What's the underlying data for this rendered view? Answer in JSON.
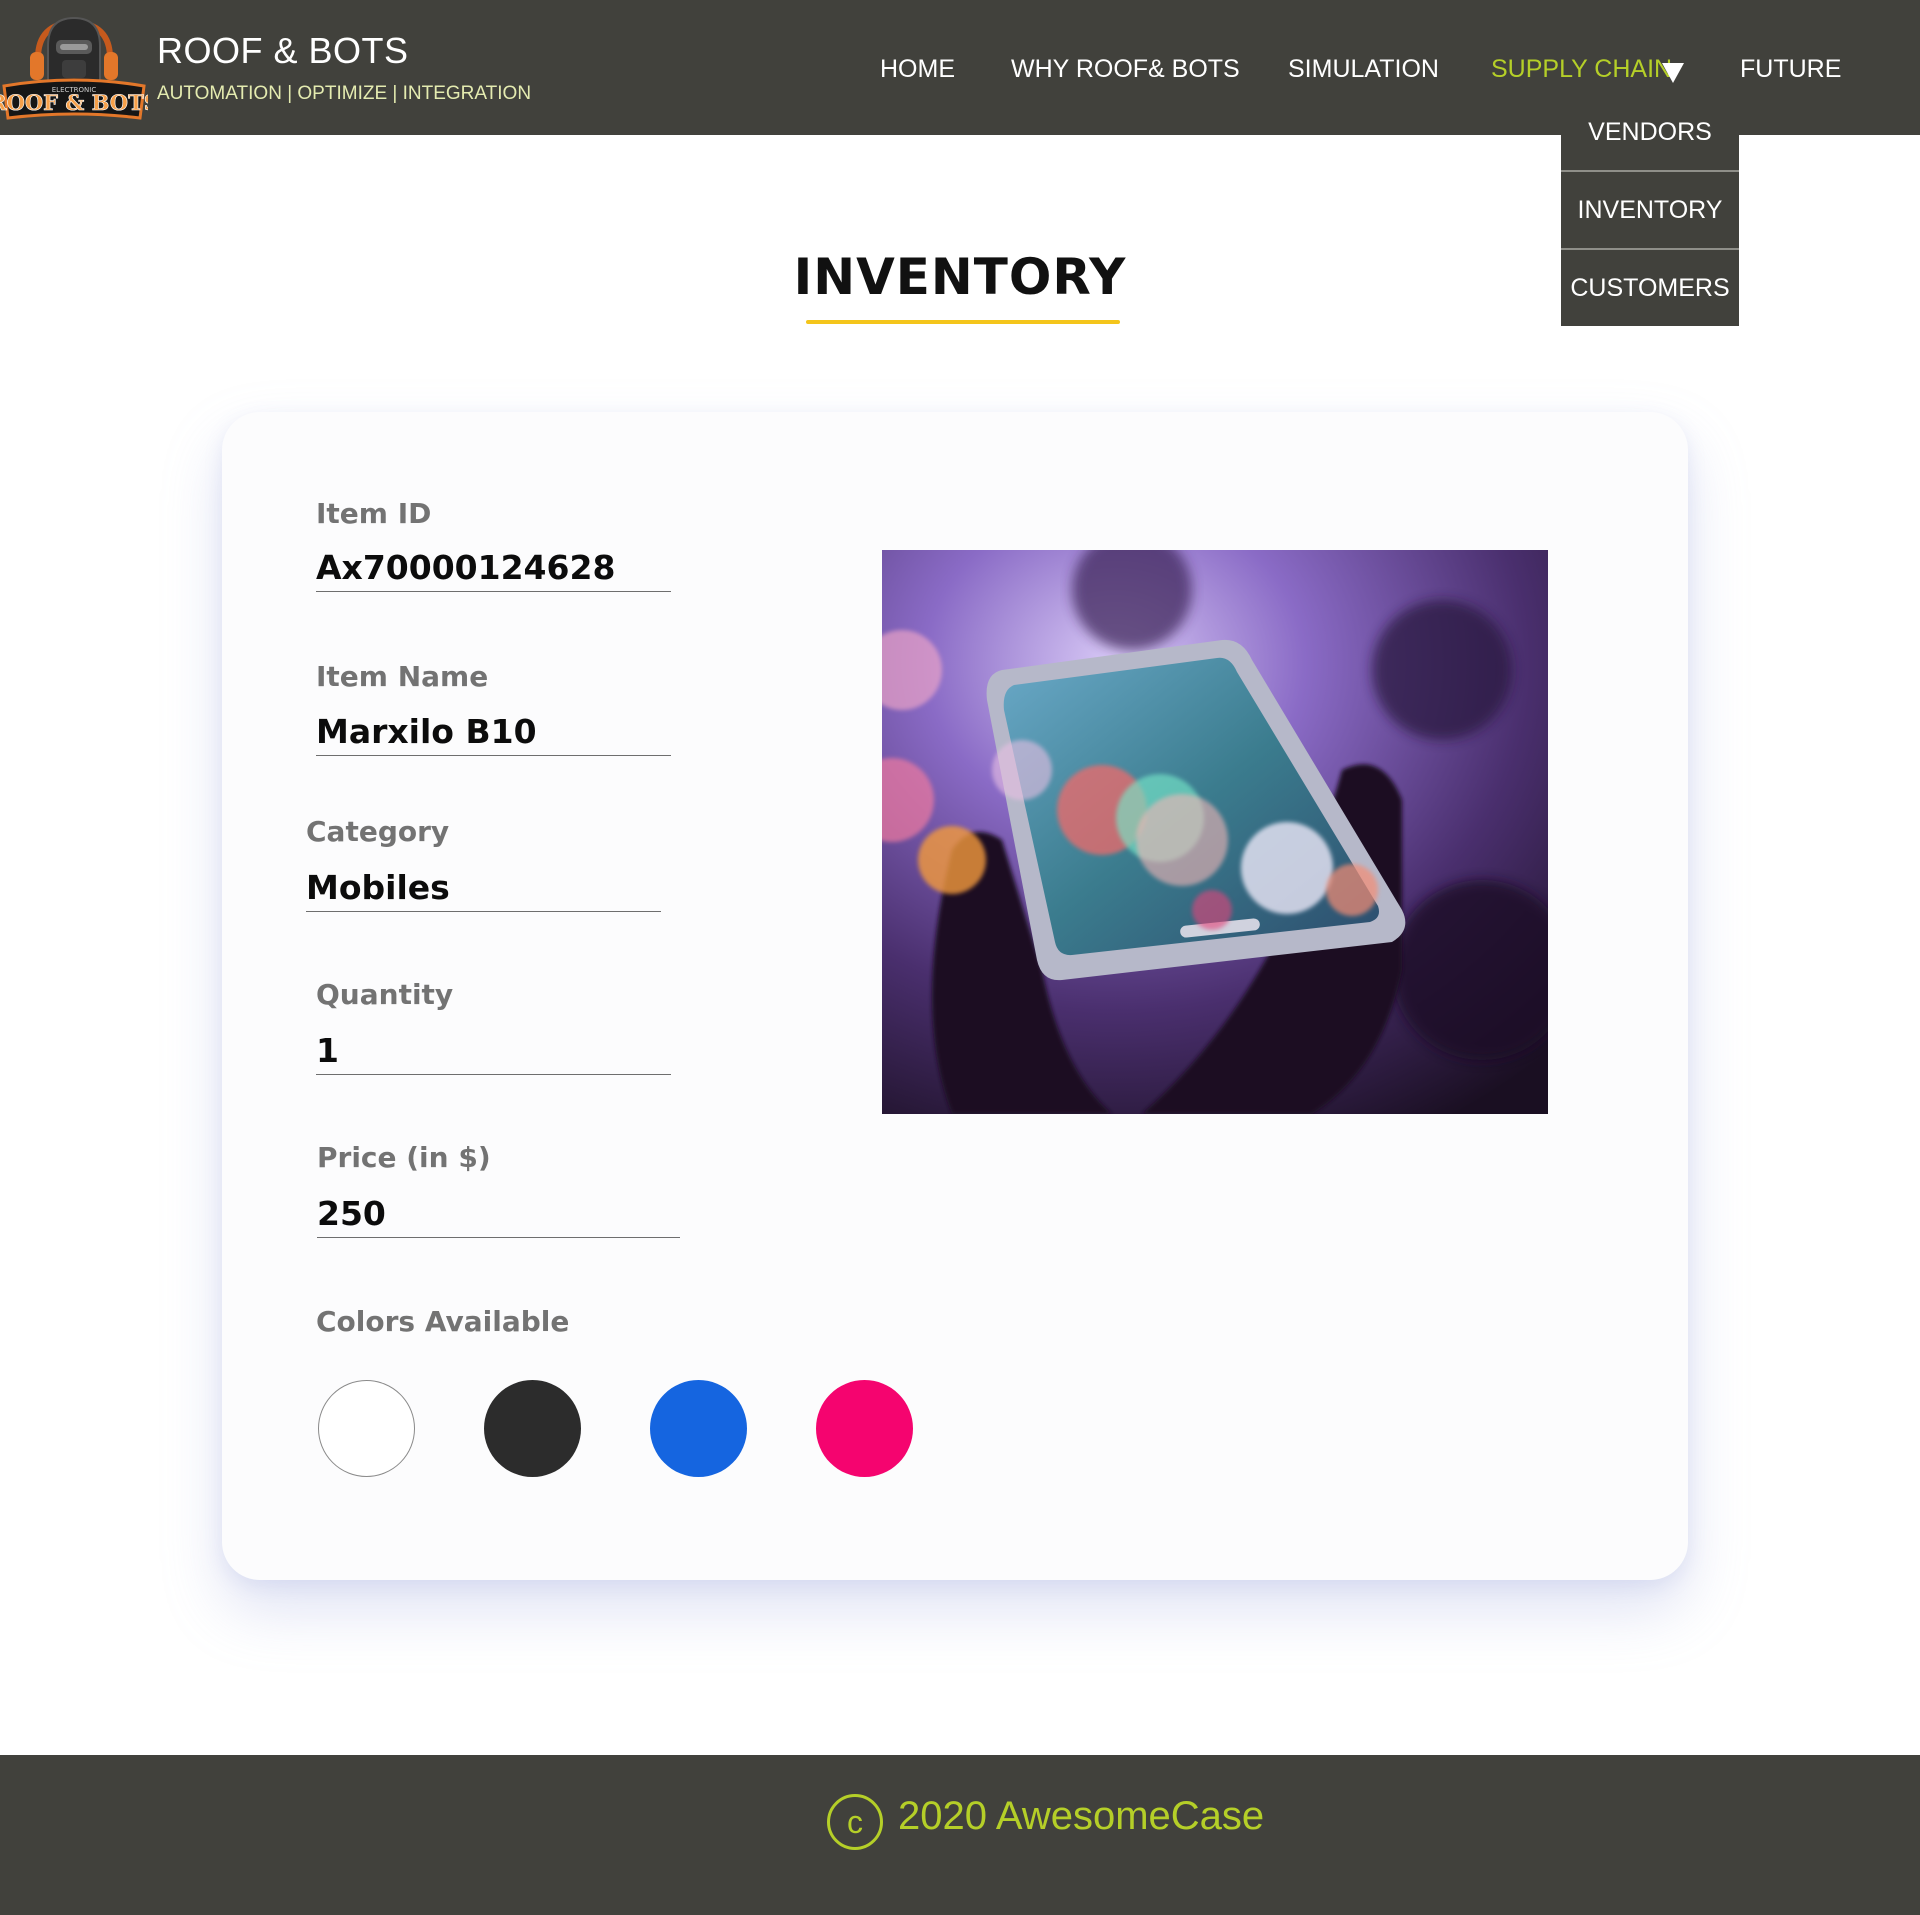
{
  "header": {
    "brand_title": "ROOF & BOTS",
    "brand_tagline": "AUTOMATION | OPTIMIZE | INTEGRATION",
    "logo_text_top": "ELECTRONIC",
    "logo_text": "ROOF & BOTS",
    "nav": {
      "home": "HOME",
      "why": "WHY ROOF& BOTS",
      "simulation": "SIMULATION",
      "supply_chain": "SUPPLY CHAIN",
      "future": "FUTURE"
    },
    "active_color": "#b5cf28",
    "background": "#41413c"
  },
  "dropdown": {
    "items": [
      "VENDORS",
      "INVENTORY",
      "CUSTOMERS"
    ]
  },
  "page": {
    "title": "INVENTORY",
    "accent": "#f4c51b"
  },
  "item": {
    "id_label": "Item ID",
    "id_value": "Ax70000124628",
    "name_label": "Item Name",
    "name_value": "Marxilo B10",
    "category_label": "Category",
    "category_value": "Mobiles",
    "quantity_label": "Quantity",
    "quantity_value": "1",
    "price_label": "Price (in $)",
    "price_value": "250",
    "colors_label": "Colors Available",
    "colors": [
      "#ffffff",
      "#2c2c2c",
      "#1565e0",
      "#f5046f"
    ],
    "photo": "phone-in-hand-bokeh-image"
  },
  "footer": {
    "copyright_symbol": "c",
    "text": "2020 AwesomeCase"
  }
}
